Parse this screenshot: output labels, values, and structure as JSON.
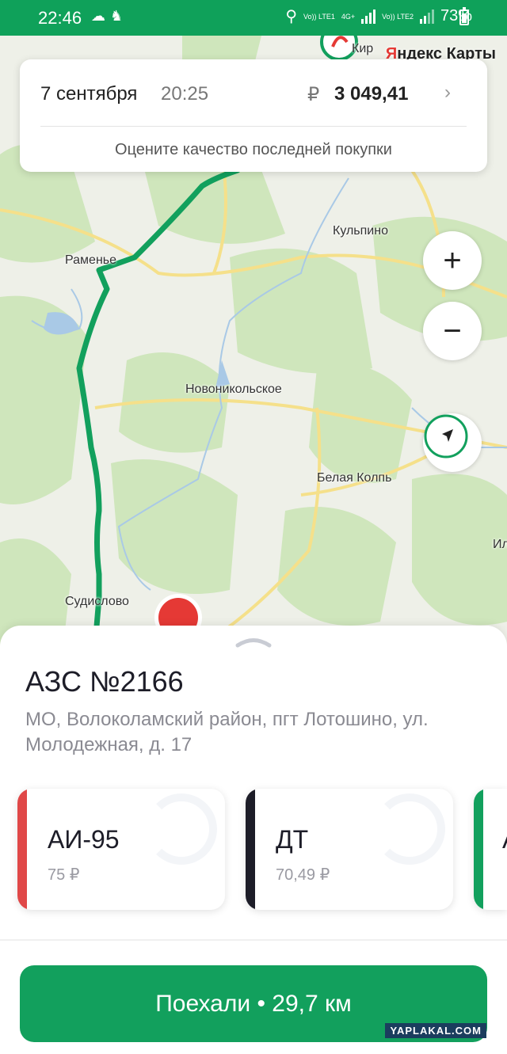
{
  "status_bar": {
    "time": "22:46",
    "net1": "Vo)) LTE1",
    "net_type": "4G+",
    "net2": "Vo)) LTE2",
    "battery": "73%",
    "icons": [
      "cloud-icon",
      "notification-icon",
      "location-icon",
      "signal-icon",
      "battery-icon"
    ]
  },
  "map": {
    "logo_prefix": "Я",
    "logo_rest": "ндекс Карты",
    "labels": {
      "kirillovo": "Кир",
      "ramenye": "Раменье",
      "kulpino": "Кульпино",
      "novonikolskoe": "Новоникольское",
      "belaya_kolp": "Белая Колпь",
      "sudislovo": "Судислово",
      "il": "Ил"
    },
    "zoom_in": "+",
    "zoom_out": "−",
    "route_color": "#12a05d"
  },
  "last_purchase": {
    "date": "7 сентября",
    "time": "20:25",
    "currency": "₽",
    "amount": "3 049,41",
    "chevron": "›",
    "rate_prompt": "Оцените качество последней покупки"
  },
  "station": {
    "title": "АЗС №2166",
    "address": "МО, Волоколамский район, пгт Лотошино, ул. Молодежная, д. 17",
    "fuels": [
      {
        "name": "АИ-95",
        "price": "75 ₽",
        "color": "#e04848"
      },
      {
        "name": "ДТ",
        "price": "70,49 ₽",
        "color": "#1d1d28"
      },
      {
        "name": "А",
        "price": "",
        "color": "#12a05d"
      }
    ]
  },
  "go_button": {
    "label": "Поехали • 29,7 км"
  },
  "watermark": "YAPLAKAL.COM"
}
